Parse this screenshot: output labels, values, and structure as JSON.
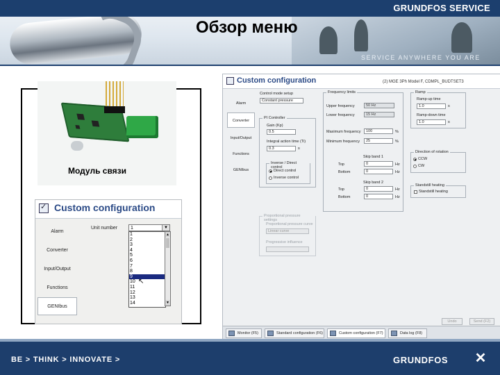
{
  "header": {
    "brand": "GRUNDFOS SERVICE",
    "page_title": "Обзор меню",
    "service_tagline": "SERVICE ANYWHERE YOU ARE"
  },
  "photo": {
    "caption": "Модуль связи"
  },
  "small_window": {
    "title": "Custom configuration",
    "sidebar": [
      "Alarm",
      "Converter",
      "Input/Output",
      "Functions",
      "GENIbus"
    ],
    "active_sidebar": "GENIbus",
    "unit_number_label": "Unit number",
    "unit_number_value": "1",
    "dropdown_options": [
      "1",
      "2",
      "3",
      "4",
      "5",
      "6",
      "7",
      "8",
      "9",
      "10",
      "11",
      "12",
      "13",
      "14"
    ],
    "selected_option": "9"
  },
  "big_window": {
    "title": "Custom configuration",
    "model": "(2) MGE 3Ph Model F, CDMPL_BUDTSET3",
    "sidebar": [
      "Alarm",
      "Converter",
      "Input/Output",
      "Functions",
      "GENIbus"
    ],
    "active_sidebar": "Converter",
    "control_mode": {
      "label": "Control mode setup",
      "value": "Constant pressure"
    },
    "pi_controller": {
      "title": "PI Controller",
      "gain_label": "Gain (Kp)",
      "gain_value": "0.5",
      "integral_label": "Integral action time (Ti)",
      "integral_value": "0.3",
      "integral_unit": "s",
      "inverse_title": "Inverse / Direct control",
      "direct_label": "Direct control",
      "inverse_label": "Inverse control"
    },
    "frequency_limits": {
      "title": "Frequency limits",
      "upper_label": "Upper frequency",
      "upper_value": "50 Hz",
      "lower_label": "Lower frequency",
      "lower_value": "15 Hz",
      "max_label": "Maximum frequency",
      "max_value": "100",
      "max_unit": "%",
      "min_label": "Minimum frequency",
      "min_value": "25",
      "min_unit": "%",
      "skip1_title": "Skip band 1",
      "skip2_title": "Skip band 2",
      "top_label": "Top",
      "bottom_label": "Bottom",
      "skip1_top": "0",
      "skip1_bottom": "0",
      "skip2_top": "0",
      "skip2_bottom": "0",
      "hz": "Hz"
    },
    "ramp": {
      "title": "Ramp",
      "up_label": "Ramp-up time",
      "up_value": "1.0",
      "down_label": "Ramp-down time",
      "down_value": "1.0",
      "unit": "s"
    },
    "direction": {
      "title": "Direction of rotation",
      "ccw": "CCW",
      "cw": "CW"
    },
    "standstill": {
      "title": "Standstill heating",
      "label": "Standstill heating"
    },
    "proportional": {
      "title": "Proportional pressure settings",
      "curve_label": "Proportional pressure curve",
      "curve_value": "Linear curve",
      "influence_label": "Progressive influence",
      "influence_value": ""
    },
    "buttons": {
      "undo": "Undo",
      "send": "Send (F2)"
    },
    "taskbar": [
      "Monitor (F5)",
      "Standard configuration (F6)",
      "Custom configuration (F7)",
      "Data log (F8)"
    ],
    "active_task": "Custom configuration (F7)"
  },
  "footer": {
    "slogan": "BE > THINK > INNOVATE >",
    "logo": "GRUNDFOS"
  }
}
